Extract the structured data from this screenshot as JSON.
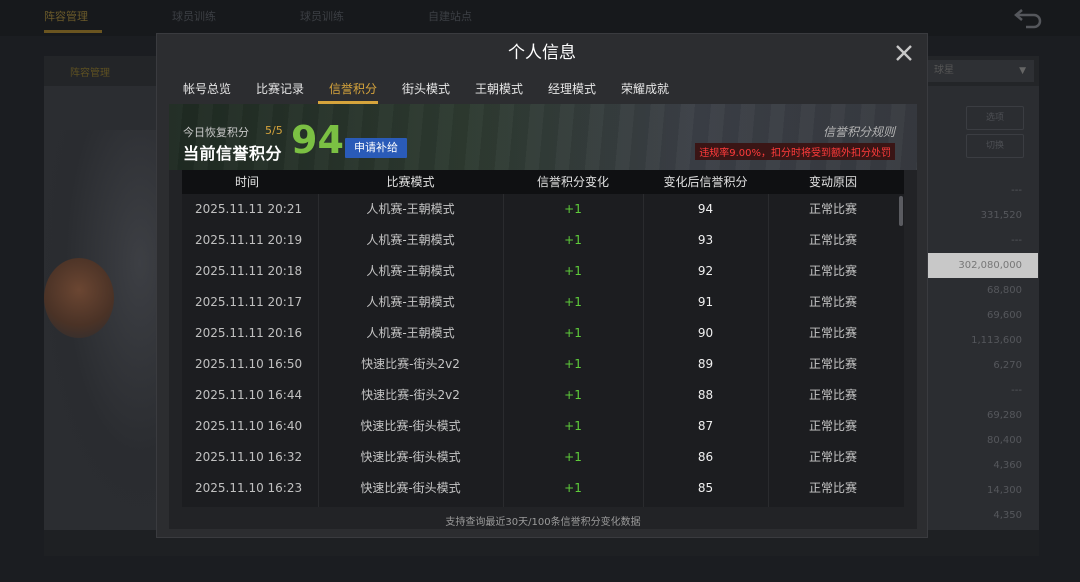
{
  "background": {
    "top_tabs": [
      "阵容管理",
      "球员训练",
      "球员训练",
      "自建站点"
    ],
    "panel_tab": "阵容管理",
    "dropdown_value": "球星",
    "buttons": [
      "选项",
      "切换"
    ],
    "list_values": [
      "---",
      "331,520",
      "---",
      "302,080,000",
      "68,800",
      "69,600",
      "1,113,600",
      "6,270",
      "---",
      "69,280",
      "80,400",
      "4,360",
      "14,300",
      "4,350"
    ]
  },
  "modal": {
    "title": "个人信息",
    "tabs": [
      "帐号总览",
      "比赛记录",
      "信誉积分",
      "街头模式",
      "王朝模式",
      "经理模式",
      "荣耀成就"
    ],
    "active_tab": "信誉积分"
  },
  "credit": {
    "recover_label": "今日恢复积分",
    "recover_count": "5/5",
    "current_label": "当前信誉积分",
    "score": "94",
    "apply_button": "申请补给",
    "rules_link": "信誉积分规则",
    "violation_note": "违规率9.00%，扣分时将受到额外扣分处罚"
  },
  "table": {
    "columns": [
      "时间",
      "比赛模式",
      "信誉积分变化",
      "变化后信誉积分",
      "变动原因"
    ],
    "rows": [
      {
        "time": "2025.11.11  20:21",
        "mode": "人机赛-王朝模式",
        "change": "+1",
        "after": "94",
        "reason": "正常比赛"
      },
      {
        "time": "2025.11.11  20:19",
        "mode": "人机赛-王朝模式",
        "change": "+1",
        "after": "93",
        "reason": "正常比赛"
      },
      {
        "time": "2025.11.11  20:18",
        "mode": "人机赛-王朝模式",
        "change": "+1",
        "after": "92",
        "reason": "正常比赛"
      },
      {
        "time": "2025.11.11  20:17",
        "mode": "人机赛-王朝模式",
        "change": "+1",
        "after": "91",
        "reason": "正常比赛"
      },
      {
        "time": "2025.11.11  20:16",
        "mode": "人机赛-王朝模式",
        "change": "+1",
        "after": "90",
        "reason": "正常比赛"
      },
      {
        "time": "2025.11.10  16:50",
        "mode": "快速比赛-街头2v2",
        "change": "+1",
        "after": "89",
        "reason": "正常比赛"
      },
      {
        "time": "2025.11.10  16:44",
        "mode": "快速比赛-街头2v2",
        "change": "+1",
        "after": "88",
        "reason": "正常比赛"
      },
      {
        "time": "2025.11.10  16:40",
        "mode": "快速比赛-街头模式",
        "change": "+1",
        "after": "87",
        "reason": "正常比赛"
      },
      {
        "time": "2025.11.10  16:32",
        "mode": "快速比赛-街头模式",
        "change": "+1",
        "after": "86",
        "reason": "正常比赛"
      },
      {
        "time": "2025.11.10  16:23",
        "mode": "快速比赛-街头模式",
        "change": "+1",
        "after": "85",
        "reason": "正常比赛"
      }
    ],
    "footer_note": "支持查询最近30天/100条信誉积分变化数据"
  },
  "colors": {
    "accent": "#d6a43c",
    "score_green": "#7bc043",
    "change_green": "#5ecb3a",
    "apply_blue": "#2a5bb8",
    "warning_red": "#ff3b3b"
  },
  "icons": {
    "close": "close-icon",
    "back": "back-arrow-icon"
  }
}
